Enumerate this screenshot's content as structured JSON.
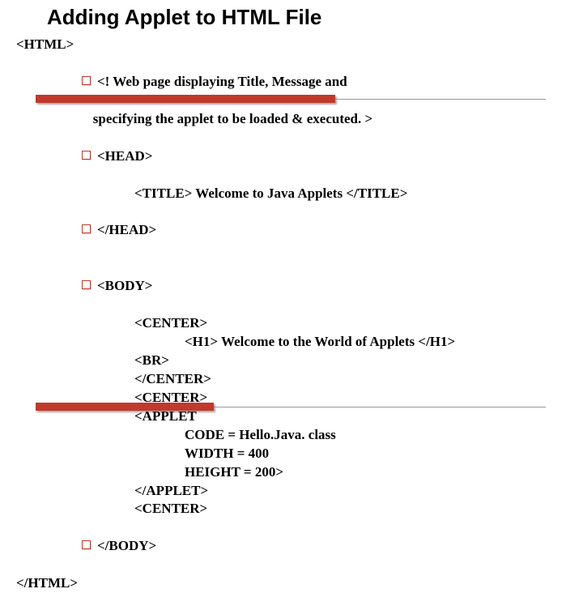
{
  "title": "Adding Applet to HTML File",
  "code": {
    "l0": "<HTML>",
    "l1a": "<! Web page displaying Title, Message and",
    "l1b": "   specifying the applet to be loaded & executed. >",
    "l2": "<HEAD>",
    "l3": "<TITLE> Welcome to Java Applets </TITLE>",
    "l4": "</HEAD>",
    "l5": "<BODY>",
    "l6": "<CENTER>",
    "l7": "<H1> Welcome to the World of Applets </H1>",
    "l8": "<BR>",
    "l9": "</CENTER>",
    "l10": "<CENTER>",
    "l11": "<APPLET",
    "l12": "CODE = Hello.Java. class",
    "l13": "WIDTH = 400",
    "l14": "HEIGHT = 200>",
    "l15": "</APPLET>",
    "l16": "<CENTER>",
    "l17": "</BODY>",
    "l18": "</HTML>"
  }
}
